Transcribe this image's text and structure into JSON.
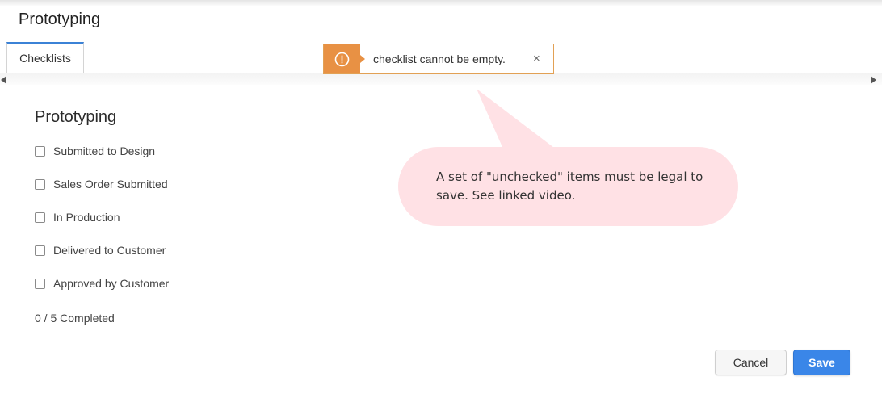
{
  "dialog": {
    "title": "Prototyping"
  },
  "tabs": [
    {
      "label": "Checklists",
      "active": true
    }
  ],
  "toast": {
    "message": "checklist cannot be empty.",
    "close_symbol": "×",
    "icon": "warning-circle-icon",
    "accent_color": "#e89144"
  },
  "checklist": {
    "title": "Prototyping",
    "items": [
      {
        "label": "Submitted to Design",
        "checked": false
      },
      {
        "label": "Sales Order Submitted",
        "checked": false
      },
      {
        "label": "In Production",
        "checked": false
      },
      {
        "label": "Delivered to Customer",
        "checked": false
      },
      {
        "label": "Approved by Customer",
        "checked": false
      }
    ],
    "progress_text": "0 / 5 Completed"
  },
  "callout": {
    "text": "A set of \"unchecked\" items must be legal to save. See linked video.",
    "color": "#ffe1e5"
  },
  "buttons": {
    "cancel_label": "Cancel",
    "save_label": "Save",
    "save_color": "#3a86e8"
  }
}
